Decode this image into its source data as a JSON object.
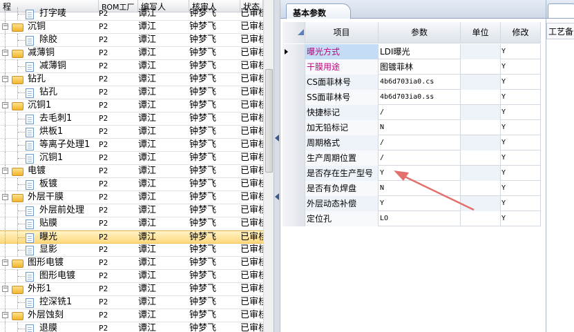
{
  "tree": {
    "headers": {
      "name": "程",
      "bom": "BOM工厂",
      "writer": "编写人",
      "reviewer": "核审人",
      "status": "状态"
    },
    "rows": [
      {
        "label": "打字唛",
        "kind": "item",
        "bom": "P2",
        "writer": "谭江",
        "reviewer": "钟梦飞",
        "status": "已审核"
      },
      {
        "label": "沉铜",
        "kind": "group",
        "bom": "P2",
        "writer": "谭江",
        "reviewer": "钟梦飞",
        "status": "已审核"
      },
      {
        "label": "除胶",
        "kind": "item",
        "bom": "P2",
        "writer": "谭江",
        "reviewer": "钟梦飞",
        "status": "已审核"
      },
      {
        "label": "减薄铜",
        "kind": "group",
        "bom": "P2",
        "writer": "谭江",
        "reviewer": "钟梦飞",
        "status": "已审核"
      },
      {
        "label": "减薄铜",
        "kind": "item",
        "bom": "P2",
        "writer": "谭江",
        "reviewer": "钟梦飞",
        "status": "已审核"
      },
      {
        "label": "钻孔",
        "kind": "group",
        "bom": "P2",
        "writer": "谭江",
        "reviewer": "钟梦飞",
        "status": "已审核"
      },
      {
        "label": "钻孔",
        "kind": "item",
        "bom": "P2",
        "writer": "谭江",
        "reviewer": "钟梦飞",
        "status": "已审核"
      },
      {
        "label": "沉铜1",
        "kind": "group",
        "bom": "P2",
        "writer": "谭江",
        "reviewer": "钟梦飞",
        "status": "已审核"
      },
      {
        "label": "去毛刺1",
        "kind": "item",
        "bom": "P2",
        "writer": "谭江",
        "reviewer": "钟梦飞",
        "status": "已审核"
      },
      {
        "label": "烘板1",
        "kind": "item",
        "bom": "P2",
        "writer": "谭江",
        "reviewer": "钟梦飞",
        "status": "已审核"
      },
      {
        "label": "等离子处理1",
        "kind": "item",
        "bom": "P2",
        "writer": "谭江",
        "reviewer": "钟梦飞",
        "status": "已审核"
      },
      {
        "label": "沉铜1",
        "kind": "item",
        "bom": "P2",
        "writer": "谭江",
        "reviewer": "钟梦飞",
        "status": "已审核"
      },
      {
        "label": "电镀",
        "kind": "group",
        "bom": "P2",
        "writer": "谭江",
        "reviewer": "钟梦飞",
        "status": "已审核"
      },
      {
        "label": "板镀",
        "kind": "item",
        "bom": "P2",
        "writer": "谭江",
        "reviewer": "钟梦飞",
        "status": "已审核"
      },
      {
        "label": "外层干膜",
        "kind": "group",
        "bom": "P2",
        "writer": "谭江",
        "reviewer": "钟梦飞",
        "status": "已审核"
      },
      {
        "label": "外层前处理",
        "kind": "item",
        "bom": "P2",
        "writer": "谭江",
        "reviewer": "钟梦飞",
        "status": "已审核"
      },
      {
        "label": "贴膜",
        "kind": "item",
        "bom": "P2",
        "writer": "谭江",
        "reviewer": "钟梦飞",
        "status": "已审核"
      },
      {
        "label": "曝光",
        "kind": "item",
        "bom": "P2",
        "writer": "谭江",
        "reviewer": "钟梦飞",
        "status": "已审核",
        "selected": true
      },
      {
        "label": "显影",
        "kind": "item",
        "bom": "P2",
        "writer": "谭江",
        "reviewer": "钟梦飞",
        "status": "已审核"
      },
      {
        "label": "图形电镀",
        "kind": "group",
        "bom": "P2",
        "writer": "谭江",
        "reviewer": "钟梦飞",
        "status": "已审核"
      },
      {
        "label": "图形电镀",
        "kind": "item",
        "bom": "P2",
        "writer": "谭江",
        "reviewer": "钟梦飞",
        "status": "已审核"
      },
      {
        "label": "外形1",
        "kind": "group",
        "bom": "P2",
        "writer": "谭江",
        "reviewer": "钟梦飞",
        "status": "已审核"
      },
      {
        "label": "控深铣1",
        "kind": "item",
        "bom": "P2",
        "writer": "谭江",
        "reviewer": "钟梦飞",
        "status": "已审核"
      },
      {
        "label": "外层蚀刻",
        "kind": "group",
        "bom": "P2",
        "writer": "谭江",
        "reviewer": "钟梦飞",
        "status": "已审核"
      },
      {
        "label": "退膜",
        "kind": "item",
        "bom": "P2",
        "writer": "谭江",
        "reviewer": "钟梦飞",
        "status": "已审核"
      }
    ]
  },
  "params": {
    "tab_label": "基本参数",
    "headers": {
      "item": "项目",
      "param": "参数",
      "unit": "单位",
      "modify": "修改"
    },
    "rows": [
      {
        "item": "曝光方式",
        "param": "LDI曝光",
        "unit": "",
        "modify": "Y",
        "highlight": true,
        "color": "#c0007f"
      },
      {
        "item": "干膜用途",
        "param": "图镀菲林",
        "unit": "",
        "modify": "Y",
        "color": "#c0007f"
      },
      {
        "item": "CS面菲林号",
        "param": "4b6d703ia0.cs",
        "unit": "",
        "modify": "Y"
      },
      {
        "item": "SS面菲林号",
        "param": "4b6d703ia0.ss",
        "unit": "",
        "modify": "Y"
      },
      {
        "item": "快捷标记",
        "param": "/",
        "unit": "",
        "modify": "Y"
      },
      {
        "item": "加无铅标记",
        "param": "N",
        "unit": "",
        "modify": "Y"
      },
      {
        "item": "周期格式",
        "param": "/",
        "unit": "",
        "modify": "Y"
      },
      {
        "item": "生产周期位置",
        "param": "/",
        "unit": "",
        "modify": "Y"
      },
      {
        "item": "是否存在生产型号",
        "param": "Y",
        "unit": "",
        "modify": "Y"
      },
      {
        "item": "是否有负焊盘",
        "param": "N",
        "unit": "",
        "modify": "Y"
      },
      {
        "item": "外层动态补偿",
        "param": "Y",
        "unit": "",
        "modify": "Y"
      },
      {
        "item": "定位孔",
        "param": "LO",
        "unit": "",
        "modify": "Y"
      }
    ]
  },
  "far_right": {
    "label": "工艺备注"
  },
  "colors": {
    "annotation_arrow": "#e2706c",
    "selected_row": "#ffd87e"
  }
}
